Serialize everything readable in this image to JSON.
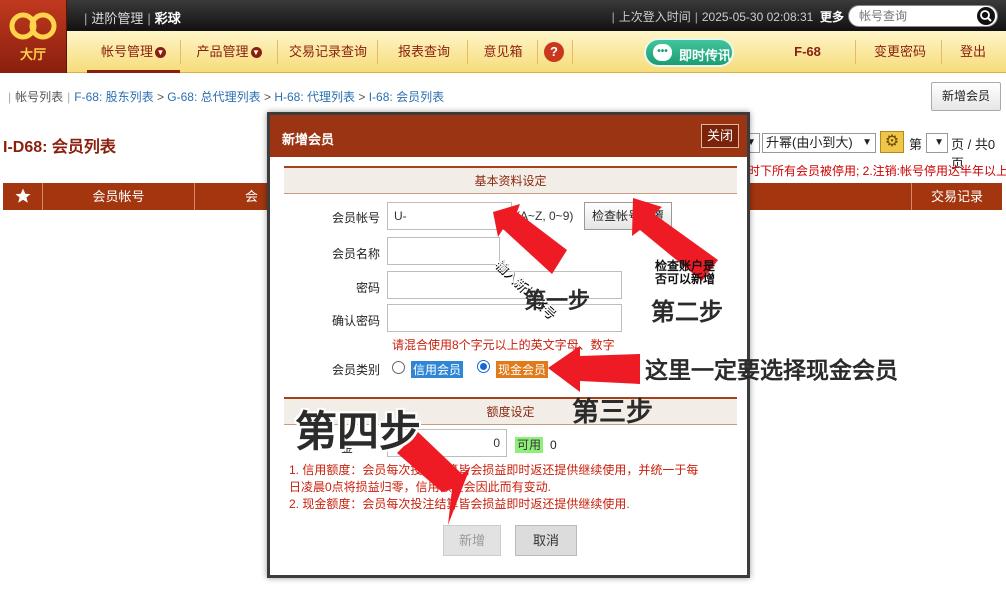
{
  "top_bar": {
    "logo_text": "大厅",
    "advanced_mgmt": "进阶管理",
    "game_type": "彩球",
    "last_login_label": "上次登入时间",
    "last_login_time": "2025-05-30 02:08:31",
    "more_label": "更多",
    "search_placeholder": "帐号查询"
  },
  "nav": {
    "account_mgmt": "帐号管理",
    "product_mgmt": "产品管理",
    "transactions": "交易记录查询",
    "reports": "报表查询",
    "feedback": "意见箱",
    "help_glyph": "?",
    "chat_label": "即时传讯",
    "user_code": "F-68",
    "change_password": "变更密码",
    "logout": "登出"
  },
  "breadcrumb": {
    "root": "帐号列表",
    "items": [
      "F-68: 股东列表",
      "G-68: 总代理列表",
      "H-68: 代理列表",
      "I-68: 会员列表"
    ]
  },
  "buttons": {
    "new_member": "新增会员"
  },
  "page_title": "I-D68: 会员列表",
  "sort": {
    "selected": "升幂(由小到大)",
    "page_prefix": "第",
    "page_suffix": "页 / 共0页"
  },
  "notice_text": "时下所有会员被停用; 2.注销:帐号停用达半年以上",
  "table": {
    "col_account": "会员帐号",
    "col_account2": "会员",
    "col_tx": "交易记录"
  },
  "modal": {
    "title": "新增会员",
    "close_label": "关闭",
    "basic_section": "基本资料设定",
    "account_label": "会员帐号",
    "account_value": "U-",
    "account_hint": "(A~Z, 0~9)",
    "check_button": "检查帐号重覆",
    "name_label": "会员名称",
    "password_label": "密码",
    "confirm_password_label": "确认密码",
    "password_note": "请混合使用8个字元以上的英文字母、数字",
    "category_label": "会员类别",
    "category_credit": "信用会员",
    "category_cash": "现金会员",
    "credit_section": "额度设定",
    "credit_label": "金",
    "credit_value": "0",
    "available_label": "可用",
    "available_value": "0",
    "rule1_line1": "1. 信用额度：会员每次投注结算皆会损益即时返还提供继续使用，并统一于每",
    "rule1_line2": "日凌晨0点将损益归零，信用额度会因此而有变动.",
    "rule2": "2. 现金额度：会员每次投注结算皆会损益即时返还提供继续使用.",
    "submit_label": "新增",
    "cancel_label": "取消"
  },
  "annotations": {
    "arrow1_note": "输入新增账号",
    "step1": "第一步",
    "check_note_line1": "检查账户是",
    "check_note_line2": "否可以新增",
    "step2": "第二步",
    "must_select": "这里一定要选择现金会员",
    "step3": "第三步",
    "step4": "第四步"
  }
}
